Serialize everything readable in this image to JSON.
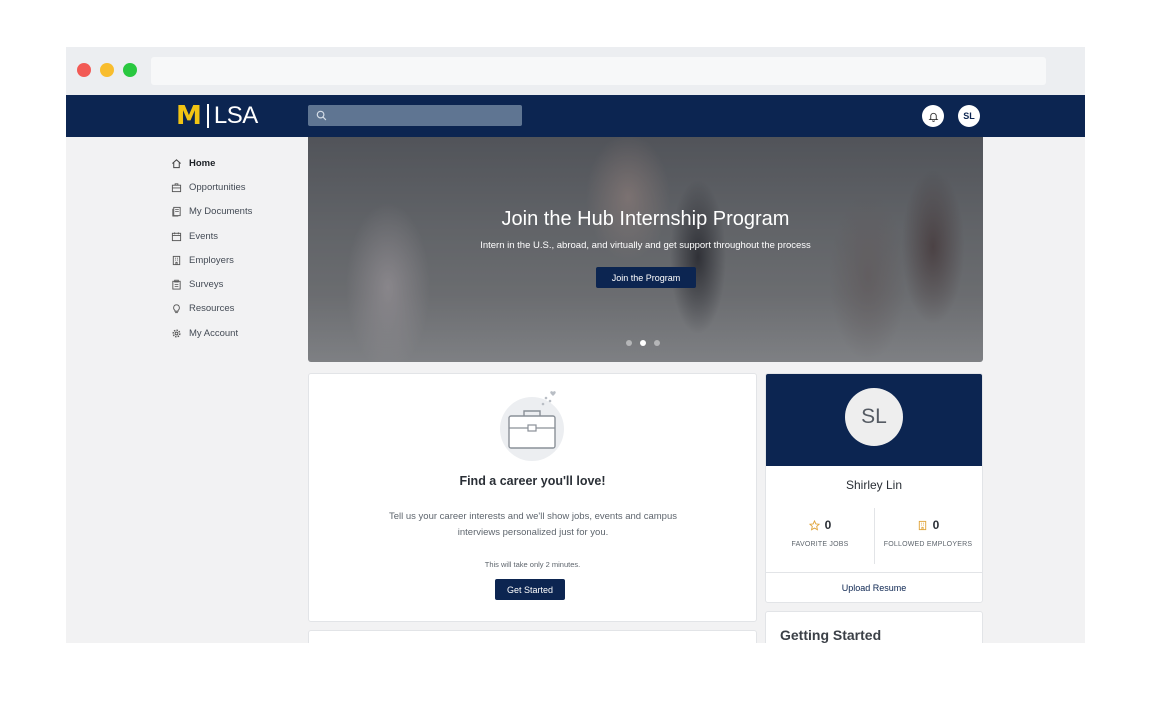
{
  "brand": {
    "logo_mark": "M",
    "logo_text": "LSA",
    "accent": "#0c2551",
    "logo_color": "#f2c413"
  },
  "header": {
    "search_placeholder": "",
    "avatar_initials": "SL"
  },
  "sidebar": {
    "items": [
      {
        "label": "Home",
        "icon": "home-icon",
        "active": true
      },
      {
        "label": "Opportunities",
        "icon": "briefcase-icon",
        "active": false
      },
      {
        "label": "My Documents",
        "icon": "documents-icon",
        "active": false
      },
      {
        "label": "Events",
        "icon": "calendar-icon",
        "active": false
      },
      {
        "label": "Employers",
        "icon": "building-icon",
        "active": false
      },
      {
        "label": "Surveys",
        "icon": "clipboard-icon",
        "active": false
      },
      {
        "label": "Resources",
        "icon": "lightbulb-icon",
        "active": false
      },
      {
        "label": "My Account",
        "icon": "gear-icon",
        "active": false
      }
    ]
  },
  "hero": {
    "title": "Join the Hub Internship Program",
    "subtitle": "Intern in the U.S., abroad, and virtually and get support throughout the process",
    "button": "Join the Program",
    "slide_count": 3,
    "active_slide": 2
  },
  "career": {
    "title": "Find a career you'll love!",
    "text": "Tell us your career interests and we'll show jobs, events and campus interviews personalized just for you.",
    "note": "This will take only 2 minutes.",
    "button": "Get Started"
  },
  "profile": {
    "initials": "SL",
    "name": "Shirley Lin",
    "favorite_jobs": {
      "value": "0",
      "label": "FAVORITE JOBS"
    },
    "followed_employers": {
      "value": "0",
      "label": "FOLLOWED EMPLOYERS"
    },
    "upload": "Upload Resume"
  },
  "getting_started": {
    "title": "Getting Started"
  }
}
